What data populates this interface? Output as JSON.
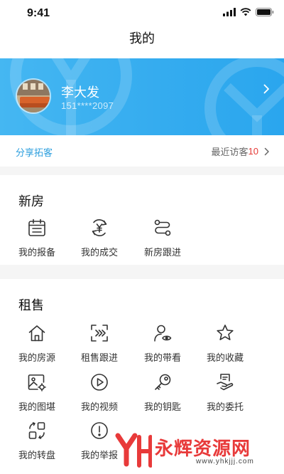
{
  "status_bar": {
    "time": "9:41",
    "signal_icon": "signal-icon",
    "wifi_icon": "wifi-icon",
    "battery_icon": "battery-icon"
  },
  "header": {
    "title": "我的"
  },
  "profile": {
    "name": "李大发",
    "phone": "151****2097",
    "chevron_icon": "chevron-right-icon"
  },
  "share": {
    "label": "分享拓客",
    "visitors_label": "最近访客",
    "visitors_count": "10"
  },
  "new_house": {
    "title": "新房",
    "items": [
      {
        "label": "我的报备",
        "icon": "calendar-icon"
      },
      {
        "label": "我的成交",
        "icon": "yuan-refresh-icon"
      },
      {
        "label": "新房跟进",
        "icon": "route-icon"
      }
    ]
  },
  "rental_sale": {
    "title": "租售",
    "items": [
      {
        "label": "我的房源",
        "icon": "house-icon"
      },
      {
        "label": "租售跟进",
        "icon": "scan-forward-icon"
      },
      {
        "label": "我的带看",
        "icon": "user-eye-icon"
      },
      {
        "label": "我的收藏",
        "icon": "star-icon"
      },
      {
        "label": "我的图堪",
        "icon": "image-settings-icon"
      },
      {
        "label": "我的视频",
        "icon": "play-circle-icon"
      },
      {
        "label": "我的钥匙",
        "icon": "key-icon"
      },
      {
        "label": "我的委托",
        "icon": "hand-document-icon"
      },
      {
        "label": "我的转盘",
        "icon": "transfer-icon"
      },
      {
        "label": "我的举报",
        "icon": "alert-circle-icon"
      }
    ]
  },
  "watermark": {
    "text": "永辉资源网",
    "url": "www.yhkjjj.com"
  },
  "colors": {
    "banner": "#35acef",
    "accent": "#2d9fde",
    "count": "#e53935",
    "watermark": "#e83a3a"
  }
}
